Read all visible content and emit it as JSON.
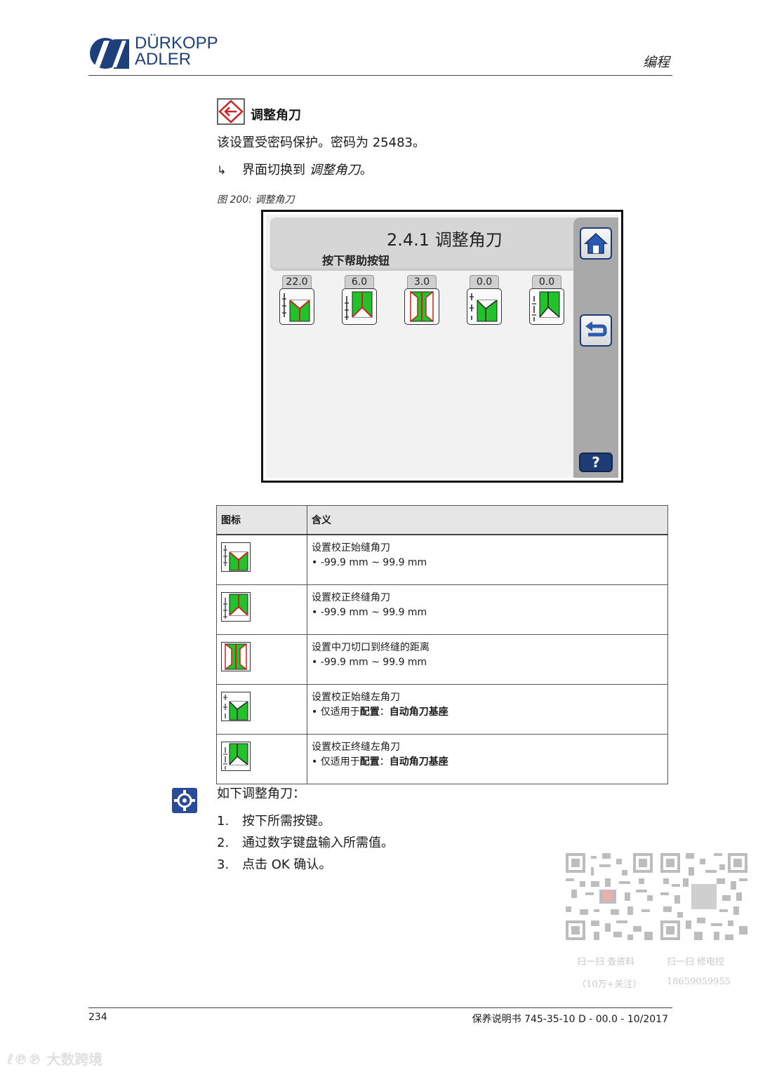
{
  "header": {
    "logo_line1": "DÜRKOPP",
    "logo_line2": "ADLER",
    "section": "编程"
  },
  "heading": "调整角刀",
  "password_note": "该设置受密码保护。密码为 25483。",
  "step": {
    "text": "界面切换到 ",
    "target": "调整角刀",
    "end": "。"
  },
  "figure_caption": "图 200: 调整角刀",
  "screen": {
    "title": "2.4.1 调整角刀",
    "subtitle": "按下帮助按钮",
    "values": [
      "22.0",
      "6.0",
      "3.0",
      "0.0",
      "0.0"
    ],
    "help_label": "?"
  },
  "table": {
    "headers": [
      "图标",
      "含义"
    ],
    "rows": [
      {
        "title": "设置校正始缝角刀",
        "bullet": "-99.9 mm ~ 99.9 mm"
      },
      {
        "title": "设置校正终缝角刀",
        "bullet": "-99.9 mm ~ 99.9 mm"
      },
      {
        "title": "设置中刀切口到终缝的距离",
        "bullet": "-99.9 mm ~ 99.9 mm"
      },
      {
        "title": "设置校正始缝左角刀",
        "bullet_prefix": "仅适用于",
        "bullet_bold": "配置",
        "bullet_suffix": "：",
        "bullet_bold2": "自动角刀基座"
      },
      {
        "title": "设置校正终缝左角刀",
        "bullet_prefix": "仅适用于",
        "bullet_bold": "配置",
        "bullet_suffix": "：",
        "bullet_bold2": "自动角刀基座"
      }
    ]
  },
  "instructions": {
    "intro": "如下调整角刀：",
    "steps": [
      {
        "num": "1.",
        "text": "按下所需按键。"
      },
      {
        "num": "2.",
        "text": "通过数字键盘输入所需值。"
      },
      {
        "num": "3.",
        "text": "点击 OK 确认。"
      }
    ]
  },
  "qr": {
    "left_caption1": "扫一扫 查资料",
    "left_caption2": "（10万+关注）",
    "right_caption1": "扫一扫 修电控",
    "right_caption2": "18659059955"
  },
  "footer": {
    "page": "234",
    "doc": "保养说明书 745-35-10 D - 00.0 - 10/2017"
  },
  "watermark": "大数跨境",
  "colors": {
    "brand": "#1d3f7a",
    "accent_green": "#22c22a",
    "accent_red": "#cc2222"
  }
}
